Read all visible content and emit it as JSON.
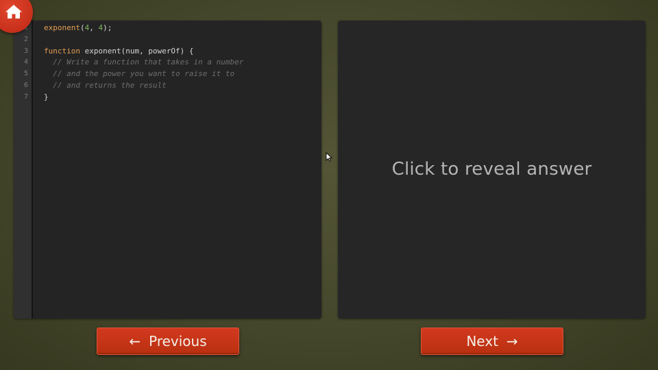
{
  "home": {
    "icon": "home-icon"
  },
  "code_editor": {
    "line_numbers": [
      "1",
      "2",
      "3",
      "4",
      "5",
      "6",
      "7"
    ],
    "lines": [
      [
        {
          "type": "fn",
          "text": "exponent"
        },
        {
          "type": "plain",
          "text": "("
        },
        {
          "type": "num",
          "text": "4"
        },
        {
          "type": "plain",
          "text": ", "
        },
        {
          "type": "num",
          "text": "4"
        },
        {
          "type": "plain",
          "text": ");"
        }
      ],
      [],
      [
        {
          "type": "kw",
          "text": "function"
        },
        {
          "type": "plain",
          "text": " exponent(num, powerOf) {"
        }
      ],
      [
        {
          "type": "comment",
          "text": "  // Write a function that takes in a number"
        }
      ],
      [
        {
          "type": "comment",
          "text": "  // and the power you want to raise it to"
        }
      ],
      [
        {
          "type": "comment",
          "text": "  // and returns the result"
        }
      ],
      [
        {
          "type": "plain",
          "text": "}"
        }
      ]
    ]
  },
  "answer_panel": {
    "reveal_text": "Click to reveal answer"
  },
  "navigation": {
    "previous_label": "Previous",
    "previous_arrow": "←",
    "next_label": "Next",
    "next_arrow": "→"
  },
  "colors": {
    "accent": "#c8301c",
    "code_function": "#e39e55",
    "code_number": "#7fb45a",
    "code_comment": "#6e6e6e"
  }
}
